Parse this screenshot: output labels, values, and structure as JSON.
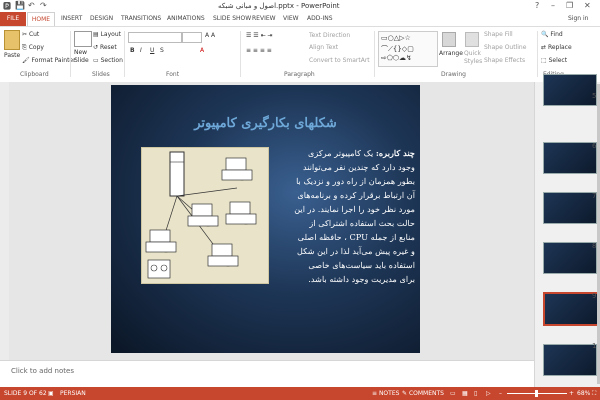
{
  "window": {
    "title": "اصول و مبانی شبکه.pptx - PowerPoint",
    "help": "?",
    "minimize": "–",
    "restore": "❐",
    "close": "✕",
    "user": "Sign in"
  },
  "quick_access": {
    "save": "💾",
    "undo": "↶",
    "redo": "↷"
  },
  "tabs": [
    "FILE",
    "HOME",
    "INSERT",
    "DESIGN",
    "TRANSITIONS",
    "ANIMATIONS",
    "SLIDE SHOW",
    "REVIEW",
    "VIEW",
    "ADD-INS"
  ],
  "ribbon": {
    "clipboard": {
      "paste": "Paste",
      "cut": "Cut",
      "copy": "Copy",
      "format_painter": "Format Painter",
      "label": "Clipboard"
    },
    "slides": {
      "new_slide": "New",
      "new_slide2": "Slide",
      "layout": "Layout",
      "reset": "Reset",
      "section": "Section",
      "label": "Slides"
    },
    "font": {
      "label": "Font"
    },
    "paragraph": {
      "text_direction": "Text Direction",
      "align_text": "Align Text",
      "convert_smartart": "Convert to SmartArt",
      "label": "Paragraph"
    },
    "drawing": {
      "arrange": "Arrange",
      "quick_styles": "Quick",
      "quick_styles2": "Styles",
      "shape_fill": "Shape Fill",
      "shape_outline": "Shape Outline",
      "shape_effects": "Shape Effects",
      "label": "Drawing"
    },
    "editing": {
      "find": "Find",
      "replace": "Replace",
      "select": "Select",
      "label": "Editing"
    }
  },
  "slide": {
    "title": "شکلهای بکارگیری کامپیوتر",
    "body_lead": "چند کاربره:",
    "body": " یک کامپیوتر مرکزی وجود دارد که چندین نفر می‌توانند بطور همزمان از راه دور و نزدیک با آن ارتباط برقرار کرده و برنامه‌های مورد نظر خود را اجرا نمایند. در این حالت بحث استفاده اشتراکی از منابع از جمله CPU ، حافظه اصلی و غیره پیش می‌آید لذا در این شکل استفاده باید سیاست‌های خاصی برای مدیریت وجود داشته باشد."
  },
  "thumbnails": [
    "5",
    "6",
    "7",
    "8",
    "9",
    "10"
  ],
  "notes_placeholder": "Click to add notes",
  "status": {
    "slide_info": "SLIDE 9 OF 62",
    "language": "PERSIAN",
    "notes": "NOTES",
    "comments": "COMMENTS",
    "zoom": "68%",
    "zoom_minus": "–",
    "zoom_plus": "+"
  }
}
